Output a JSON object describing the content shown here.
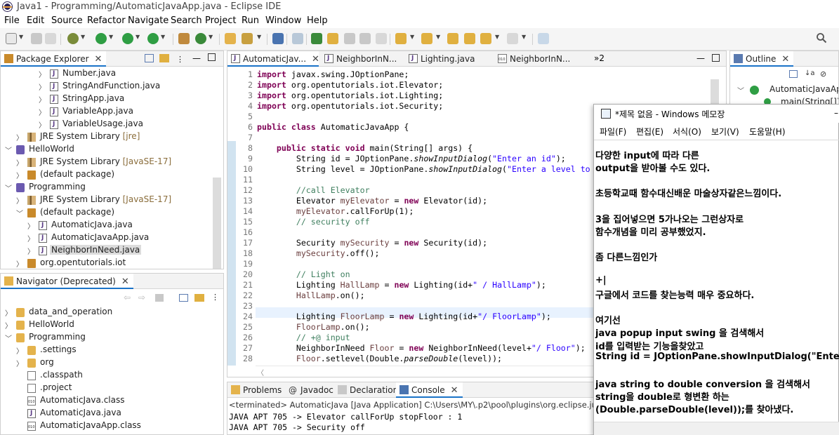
{
  "window": {
    "title": "Java1 - Programming/AutomaticJavaApp.java - Eclipse IDE"
  },
  "menubar": [
    "File",
    "Edit",
    "Source",
    "Refactor",
    "Navigate",
    "Search",
    "Project",
    "Run",
    "Window",
    "Help"
  ],
  "package_explorer": {
    "tab": "Package Explorer",
    "rows": [
      {
        "label": "Number.java",
        "deco": ""
      },
      {
        "label": "StringAndFunction.java",
        "deco": ""
      },
      {
        "label": "StringApp.java",
        "deco": ""
      },
      {
        "label": "VariableApp.java",
        "deco": ""
      },
      {
        "label": "VariableUsage.java",
        "deco": ""
      },
      {
        "label": "JRE System Library",
        "deco": "[jre]"
      },
      {
        "label": "HelloWorld",
        "deco": ""
      },
      {
        "label": "JRE System Library",
        "deco": "[JavaSE-17]"
      },
      {
        "label": "(default package)",
        "deco": ""
      },
      {
        "label": "Programming",
        "deco": ""
      },
      {
        "label": "JRE System Library",
        "deco": "[JavaSE-17]"
      },
      {
        "label": "(default package)",
        "deco": ""
      },
      {
        "label": "AutomaticJava.java",
        "deco": ""
      },
      {
        "label": "AutomaticJavaApp.java",
        "deco": ""
      },
      {
        "label": "NeighborInNeed.java",
        "deco": ""
      },
      {
        "label": "org.opentutorials.iot",
        "deco": ""
      }
    ]
  },
  "navigator": {
    "tab": "Navigator (Deprecated)",
    "rows": [
      "data_and_operation",
      "HelloWorld",
      "Programming",
      ".settings",
      "org",
      ".classpath",
      ".project",
      "AutomaticJava.class",
      "AutomaticJava.java",
      "AutomaticJavaApp.class"
    ]
  },
  "editor": {
    "tabs": [
      "AutomaticJav...",
      "NeighborInN...",
      "Lighting.java",
      "NeighborInN..."
    ],
    "overflow": "»2",
    "lines": [
      {
        "n": "1",
        "html": "<span class=\"kw\">import</span> javax.swing.JOptionPane;"
      },
      {
        "n": "2",
        "html": "<span class=\"kw\">import</span> org.opentutorials.iot.Elevator;"
      },
      {
        "n": "3",
        "html": "<span class=\"kw\">import</span> org.opentutorials.iot.Lighting;"
      },
      {
        "n": "4",
        "html": "<span class=\"kw\">import</span> org.opentutorials.iot.Security;"
      },
      {
        "n": "5",
        "html": ""
      },
      {
        "n": "6",
        "html": "<span class=\"kw\">public class</span> AutomaticJavaApp {"
      },
      {
        "n": "7",
        "html": ""
      },
      {
        "n": "8",
        "html": "    <span class=\"kw\">public static void</span> main(String[] args) {"
      },
      {
        "n": "9",
        "html": "        String id = JOptionPane.<span class=\"it\">showInputDialog</span>(<span class=\"st\">\"Enter an id\"</span>);"
      },
      {
        "n": "10",
        "html": "        String level = JOptionPane.<span class=\"it\">showInputDialog</span>(<span class=\"st\">\"Enter a level to</span>"
      },
      {
        "n": "11",
        "html": ""
      },
      {
        "n": "12",
        "html": "        <span class=\"cm\">//call Elevator</span>"
      },
      {
        "n": "13",
        "html": "        Elevator <span class=\"fld\">myElevator</span> = <span class=\"kw\">new</span> Elevator(id);"
      },
      {
        "n": "14",
        "html": "        <span class=\"fld\">myElevator</span>.callForUp(1);"
      },
      {
        "n": "15",
        "html": "        <span class=\"cm\">// security off</span>"
      },
      {
        "n": "16",
        "html": ""
      },
      {
        "n": "17",
        "html": "        Security <span class=\"fld\">mySecurity</span> = <span class=\"kw\">new</span> Security(id);"
      },
      {
        "n": "18",
        "html": "        <span class=\"fld\">mySecurity</span>.off();"
      },
      {
        "n": "19",
        "html": ""
      },
      {
        "n": "20",
        "html": "        <span class=\"cm\">// Light on</span>"
      },
      {
        "n": "21",
        "html": "        Lighting <span class=\"fld\">HallLamp</span> = <span class=\"kw\">new</span> Lighting(id+<span class=\"st\">\" / HallLamp\"</span>);"
      },
      {
        "n": "22",
        "html": "        <span class=\"fld\">HallLamp</span>.on();"
      },
      {
        "n": "23",
        "html": ""
      },
      {
        "n": "24",
        "html": "        Lighting <span class=\"fld\">FloorLamp</span> = <span class=\"kw\">new</span> Lighting(id+<span class=\"st\">\"/ FloorLamp\"</span>);"
      },
      {
        "n": "25",
        "html": "        <span class=\"fld\">FloorLamp</span>.on();"
      },
      {
        "n": "26",
        "html": "        <span class=\"cm\">// +@ input</span>"
      },
      {
        "n": "27",
        "html": "        NeighborInNeed <span class=\"fld\">Floor</span> = <span class=\"kw\">new</span> NeighborInNeed(level+<span class=\"st\">\"/ Floor\"</span>);"
      },
      {
        "n": "28",
        "html": "        <span class=\"fld\">Floor</span>.setlevel(Double.<span class=\"it\">parseDouble</span>(level));"
      }
    ]
  },
  "bottom": {
    "tabs": [
      "Problems",
      "Javadoc",
      "Declaration",
      "Console"
    ],
    "status": "<terminated> AutomaticJava [Java Application] C:\\Users\\MY\\.p2\\pool\\plugins\\org.eclipse.jus",
    "output": [
      "JAVA APT 705 -> Elevator callForUp stopFloor : 1",
      "JAVA APT 705 -> Security off"
    ]
  },
  "outline": {
    "tab": "Outline",
    "rows": [
      "AutomaticJavaApp",
      "main(String[]) :"
    ]
  },
  "notepad": {
    "title": "*제목 없음 - Windows 메모장",
    "menu": [
      "파일(F)",
      "편집(E)",
      "서식(O)",
      "보기(V)",
      "도움말(H)"
    ],
    "lines": [
      "다양한 input에 따라 다른",
      "output을 받아볼 수도 있다.",
      "",
      "초등학교때 함수대신배운 마술상자같은느낌이다.",
      "",
      "3을 집어넣으면 5가나오는 그런상자로",
      "함수개념을 미리 공부했었지.",
      "",
      "좀 다른느낌인가",
      "",
      "+|",
      "구글에서 코드를 찾는능력 매우 중요하다.",
      "",
      "여기선",
      " java popup input swing 을 검색해서",
      "id를 입력받는 기능을찾았고",
      "String id = JOptionPane.showInputDialog(\"Enter an",
      "",
      "java string to double conversion 을 검색해서",
      "string을 double로 형변환 하는",
      "(Double.parseDouble(level));를 찾아냈다."
    ]
  }
}
